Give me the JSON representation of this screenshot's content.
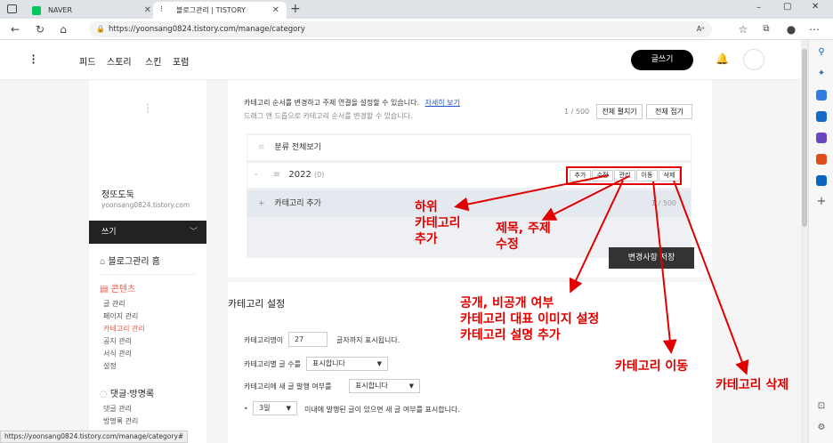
{
  "browser": {
    "tabs": [
      {
        "title": "NAVER"
      },
      {
        "title": "블로그관리 | TISTORY"
      }
    ],
    "url": "https://yoonsang0824.tistory.com/manage/category",
    "status_url": "https://yoonsang0824.tistory.com/manage/category#"
  },
  "header": {
    "nav": [
      "피드",
      "스토리",
      "스킨",
      "포럼"
    ],
    "write_label": "글쓰기"
  },
  "sidebar": {
    "blog_name": "정또도둑",
    "blog_url": "yoonsang0824.tistory.com",
    "write_label": "쓰기",
    "home_label": "블로그관리 홈",
    "contents_label": "콘텐츠",
    "contents_items": [
      "글 관리",
      "페이지 관리",
      "카테고리 관리",
      "공지 관리",
      "서식 관리",
      "설정"
    ],
    "comments_label": "댓글·방명록",
    "comments_items": [
      "댓글 관리",
      "방명록 관리"
    ]
  },
  "category": {
    "desc_line1": "카테고리 순서를 변경하고 주제 연결을 설정할 수 있습니다.",
    "detail_link": "자세히 보기",
    "desc_line2": "드래그 앤 드롭으로 카테고리 순서를 변경할 수 있습니다.",
    "count": "1 / 500",
    "expand_all": "전체 펼치기",
    "collapse_all": "전체 접기",
    "all_label": "분류 전체보기",
    "item_name": "2022",
    "item_count": "(0)",
    "item_actions": [
      "추가",
      "수정",
      "관리",
      "이동",
      "삭제"
    ],
    "add_label": "카테고리 추가",
    "add_count": "1 / 500",
    "save_label": "변경사항 저장"
  },
  "settings": {
    "title": "카테고리 설정",
    "name_len_label": "카테고리명이",
    "name_len_value": "27",
    "name_len_suffix": "글자까지 표시됩니다.",
    "post_count_label": "카테고리별 글 수를",
    "post_count_value": "표시합니다",
    "new_post_label": "카테고리에 새 글 발행 여부를",
    "new_post_value": "표시합니다",
    "days_value": "3일",
    "days_suffix": "이내에 발행된 글이 있으면 새 글 여부를 표시합니다."
  },
  "annotations": {
    "sub_category": "하위\n카테고리\n추가",
    "edit_title": "제목, 주제\n수정",
    "manage": "공개, 비공개 여부\n카테고리 대표 이미지 설정\n카테고리 설명 추가",
    "move": "카테고리 이동",
    "delete": "카테고리 삭제"
  },
  "colors": {
    "annotation": "#e00000",
    "active_menu": "#ff5544"
  }
}
